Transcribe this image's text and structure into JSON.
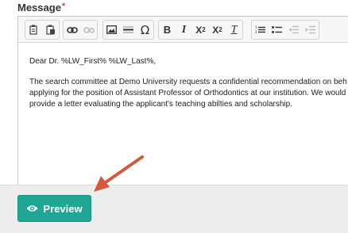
{
  "form": {
    "message_label": "Message",
    "required_mark": "*"
  },
  "toolbar": {
    "groups": [
      [
        "paste-icon",
        "paste-from-word-icon"
      ],
      [
        "link-icon",
        "unlink-icon"
      ],
      [
        "image-icon",
        "horizontal-line-icon",
        "special-character-icon"
      ],
      [
        "bold-icon",
        "italic-icon",
        "subscript-icon",
        "superscript-icon",
        "remove-format-icon"
      ],
      [
        "numbered-list-icon",
        "bulleted-list-icon",
        "decrease-indent-icon",
        "increase-indent-icon"
      ]
    ],
    "bold": "B",
    "italic": "I",
    "subscript_base": "X",
    "subscript_mark": "2",
    "superscript_base": "X",
    "superscript_mark": "2",
    "remove_format": "T",
    "special_char": "Ω"
  },
  "editor": {
    "greeting": "Dear Dr. %LW_First% %LW_Last%,",
    "body_lines": [
      "The search committee at Demo University requests a confidential recommendation on beh",
      "applying for the position of Assistant Professor of Orthodontics at our institution. We would",
      "provide a letter evaluating the applicant's teaching abilties and scholarship."
    ]
  },
  "actions": {
    "preview_label": "Preview",
    "preview_icon": "eye-icon"
  },
  "colors": {
    "primary_button": "#1fa695",
    "required": "#e0413a",
    "annotation_arrow": "#d2593a"
  }
}
